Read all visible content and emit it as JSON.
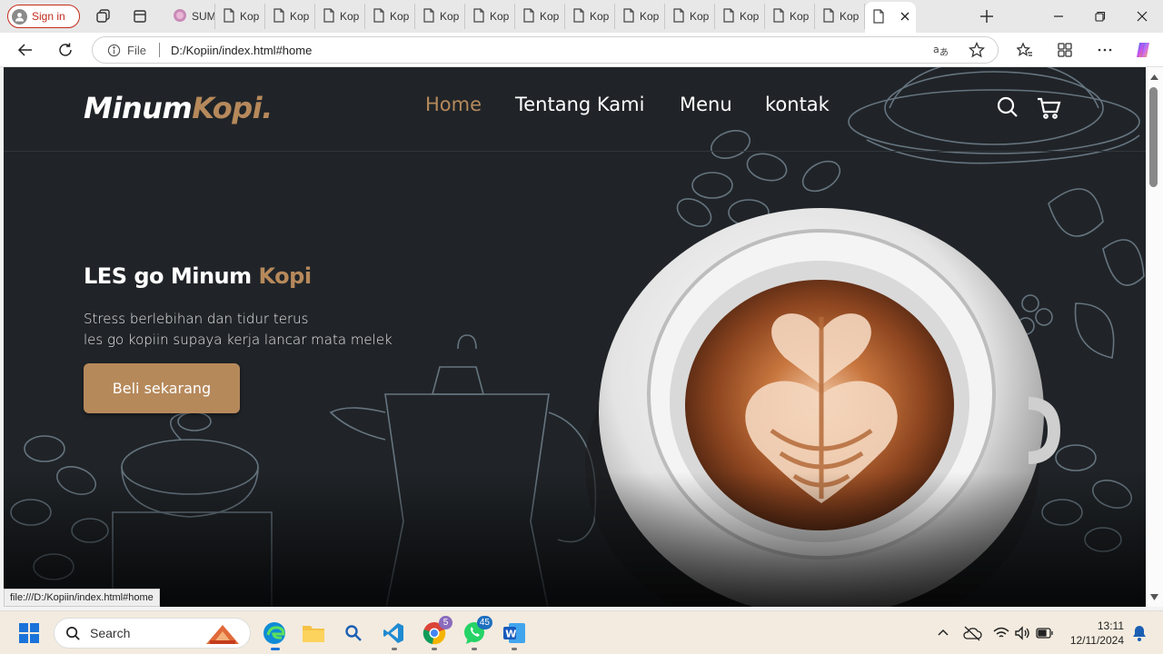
{
  "browser": {
    "sign_in": "Sign in",
    "tabs": [
      {
        "label": "SUM"
      },
      {
        "label": "Kop"
      },
      {
        "label": "Kop"
      },
      {
        "label": "Kop"
      },
      {
        "label": "Kop"
      },
      {
        "label": "Kop"
      },
      {
        "label": "Kop"
      },
      {
        "label": "Kop"
      },
      {
        "label": "Kop"
      },
      {
        "label": "Kop"
      },
      {
        "label": "Kop"
      },
      {
        "label": "Kop"
      },
      {
        "label": "Kop"
      },
      {
        "label": "Kop"
      },
      {
        "label": "Kop"
      }
    ],
    "address": {
      "scheme_label": "File",
      "url": "D:/Kopiin/index.html#home"
    },
    "status_url": "file:///D:/Kopiin/index.html#home"
  },
  "site": {
    "logo_main": "Minum",
    "logo_accent": "Kopi",
    "logo_dot": ".",
    "nav": [
      "Home",
      "Tentang Kami",
      "Menu",
      "kontak"
    ],
    "hero": {
      "title_main": "LES go Minum ",
      "title_accent": "Kopi",
      "line1": "Stress berlebihan dan tidur terus",
      "line2": "les go kopiin supaya kerja lancar mata melek",
      "cta": "Beli sekarang"
    },
    "colors": {
      "accent": "#b6895b",
      "background": "#202428"
    }
  },
  "taskbar": {
    "search_placeholder": "Search",
    "chrome_badge": "5",
    "whatsapp_badge": "45",
    "time": "13:11",
    "date": "12/11/2024"
  }
}
